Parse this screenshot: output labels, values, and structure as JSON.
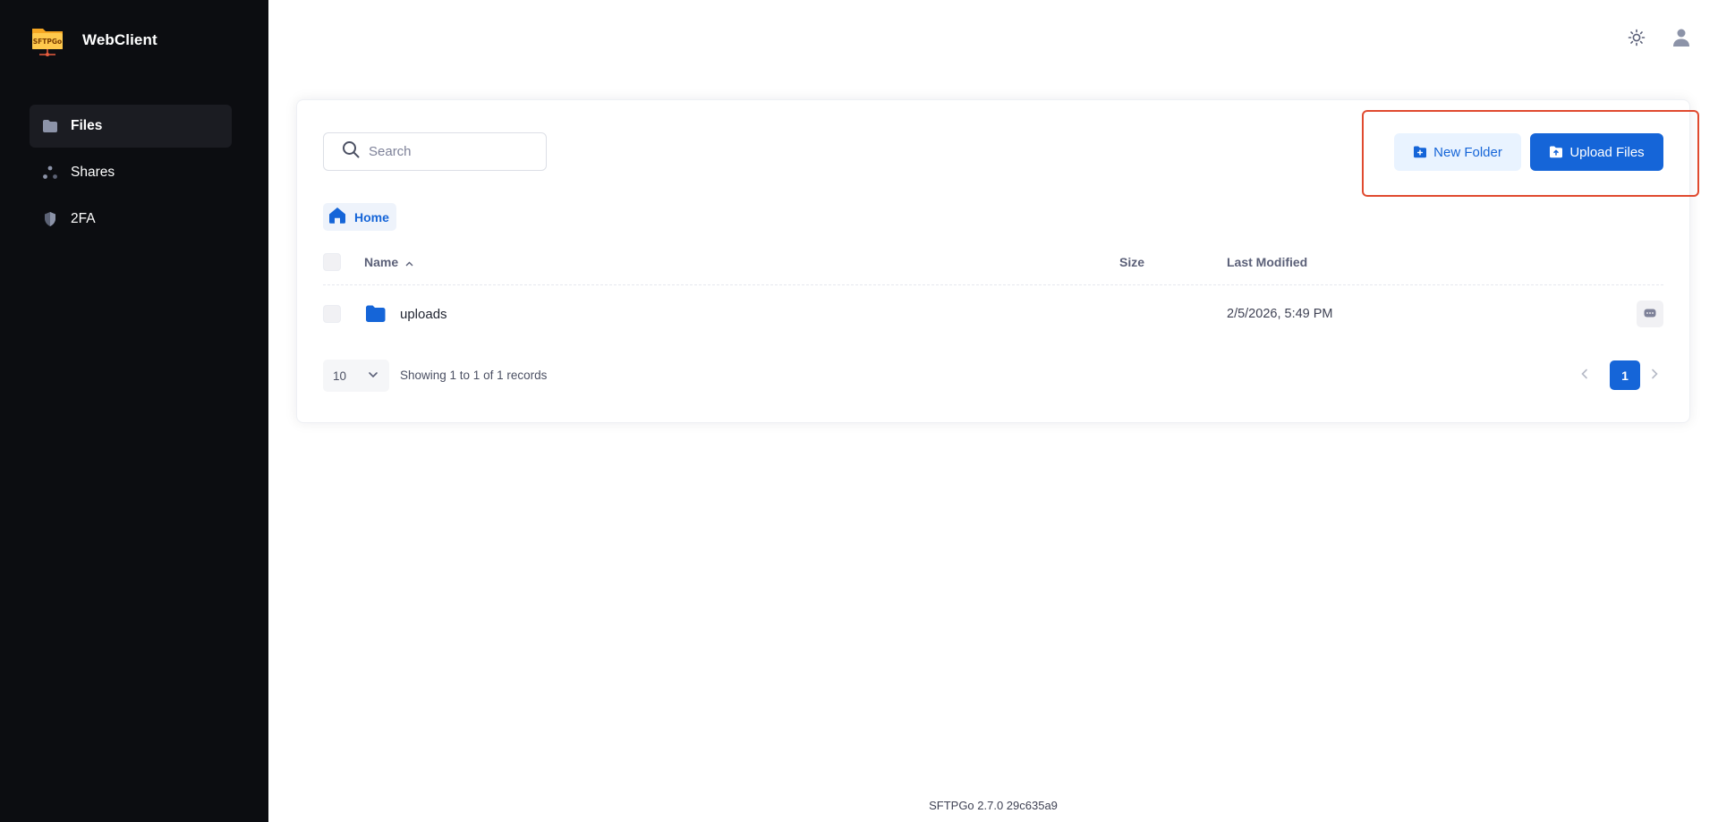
{
  "app": {
    "name": "WebClient",
    "logo_text": "SFTPGo"
  },
  "colors": {
    "sidebar_bg": "#0c0d11",
    "primary": "#1565d8",
    "primary_light": "#e9f3ff",
    "highlight_outline": "#e04a2f"
  },
  "sidebar": {
    "items": [
      {
        "label": "Files",
        "icon": "folder-icon",
        "active": true
      },
      {
        "label": "Shares",
        "icon": "share-icon",
        "active": false
      },
      {
        "label": "2FA",
        "icon": "shield-icon",
        "active": false
      }
    ]
  },
  "topbar": {
    "theme_icon": "sun-icon",
    "user_icon": "user-icon"
  },
  "search": {
    "placeholder": "Search",
    "value": ""
  },
  "toolbar": {
    "new_folder_label": "New Folder",
    "upload_label": "Upload Files"
  },
  "breadcrumb": {
    "home_label": "Home"
  },
  "table": {
    "columns": {
      "name": "Name",
      "size": "Size",
      "modified": "Last Modified"
    },
    "rows": [
      {
        "name": "uploads",
        "type": "folder",
        "size": "",
        "modified": "2/5/2026, 5:49 PM"
      }
    ]
  },
  "pagination": {
    "page_size": "10",
    "info": "Showing 1 to 1 of 1 records",
    "current_page": "1"
  },
  "footer": {
    "version": "SFTPGo 2.7.0 29c635a9"
  }
}
